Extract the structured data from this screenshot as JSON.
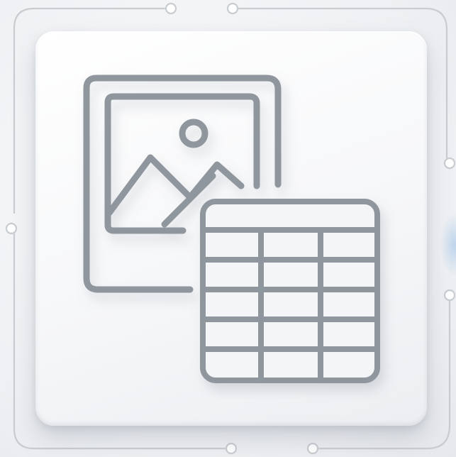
{
  "icon": {
    "name": "image-and-table-icon",
    "description_words": [
      "picture-frame-icon",
      "mountain-icon",
      "sun-icon",
      "table-grid-icon"
    ],
    "table_rows": 6,
    "table_cols": 3
  },
  "colors": {
    "background": "#eef0f3",
    "card": "#f6f7f9",
    "stroke": "#8f969e",
    "circuit": "#c9ccd1"
  }
}
